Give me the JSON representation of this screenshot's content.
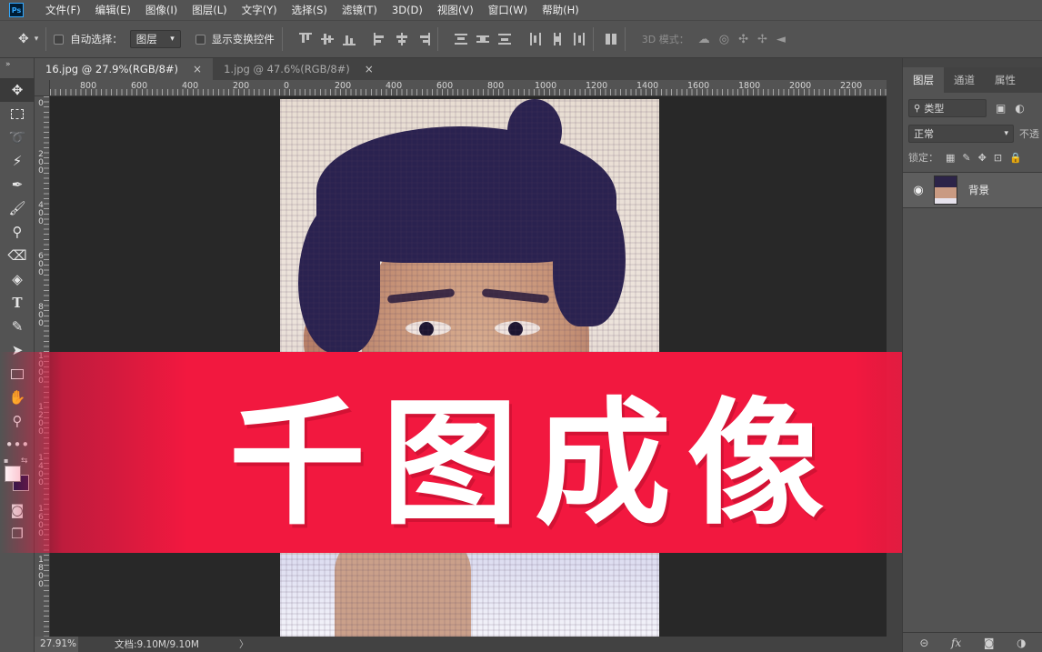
{
  "app": {
    "logo": "Ps"
  },
  "menu": [
    "文件(F)",
    "编辑(E)",
    "图像(I)",
    "图层(L)",
    "文字(Y)",
    "选择(S)",
    "滤镜(T)",
    "3D(D)",
    "视图(V)",
    "窗口(W)",
    "帮助(H)"
  ],
  "options": {
    "auto_select_label": "自动选择：",
    "auto_select_target": "图层",
    "show_transform_label": "显示变换控件",
    "mode_3d_label": "3D 模式："
  },
  "tabs": [
    {
      "label": "16.jpg @ 27.9%(RGB/8#)",
      "close": "×"
    },
    {
      "label": "1.jpg @ 47.6%(RGB/8#)",
      "close": "×"
    }
  ],
  "ruler": {
    "top_labels": [
      "800",
      "600",
      "400",
      "200",
      "0",
      "200",
      "400",
      "600",
      "800",
      "1000",
      "1200",
      "1400",
      "1600",
      "1800",
      "2000",
      "2200"
    ],
    "left_labels": [
      "0",
      "200",
      "400",
      "600",
      "800",
      "1000",
      "1200",
      "1400",
      "1600",
      "1800"
    ]
  },
  "overlay": {
    "title": "千图成像"
  },
  "status": {
    "zoom": "27.91%",
    "doc_info": "文档:9.10M/9.10M",
    "arrow": "〉"
  },
  "layers_panel": {
    "tabs": [
      "图层",
      "通道",
      "属性"
    ],
    "filter_label": "类型",
    "blend_mode": "正常",
    "opacity_label": "不透",
    "lock_label": "锁定：",
    "layer_name": "背景"
  },
  "icons": {
    "move_tool": "move-icon",
    "marquee": "rect-marquee-icon",
    "lasso": "lasso-icon",
    "magic": "quick-select-icon",
    "crop": "crop-icon",
    "brush": "brush-icon",
    "stamp": "clone-stamp-icon",
    "eraser": "eraser-icon",
    "bucket": "paint-bucket-icon",
    "type": "type-icon",
    "pen": "pen-icon",
    "select": "path-select-icon",
    "shape": "rectangle-tool-icon",
    "hand": "hand-icon",
    "zoom": "zoom-icon",
    "more": "more-icon"
  },
  "colors": {
    "banner": "#f2183f",
    "foreground": "#ffffff",
    "background": "#17174a"
  }
}
